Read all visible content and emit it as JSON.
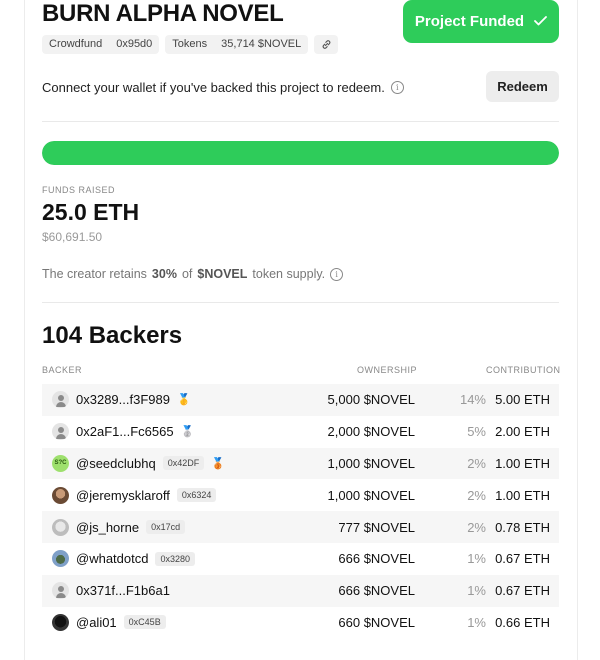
{
  "project": {
    "title": "BURN ALPHA NOVEL",
    "funded_label": "Project Funded",
    "tags": {
      "type_label": "Crowdfund",
      "address": "0x95d0",
      "tokens_label": "Tokens",
      "tokens_value": "35,714 $NOVEL"
    }
  },
  "wallet": {
    "message": "Connect your wallet if you've backed this project to redeem.",
    "redeem_label": "Redeem"
  },
  "funding": {
    "progress": 1.0,
    "raised_label": "FUNDS RAISED",
    "raised_value": "25.0 ETH",
    "raised_usd": "$60,691.50",
    "retain_prefix": "The creator retains",
    "retain_pct": "30%",
    "retain_of": "of",
    "retain_token": "$NOVEL",
    "retain_suffix": "token supply."
  },
  "backers": {
    "title": "104 Backers",
    "columns": {
      "backer": "BACKER",
      "ownership": "OWNERSHIP",
      "contribution": "CONTRIBUTION"
    },
    "rows": [
      {
        "name": "0x3289...f3F989",
        "addr": "",
        "medal": "gold",
        "ownership": "5,000 $NOVEL",
        "pct": "14%",
        "contribution": "5.00 ETH",
        "avatar": "default"
      },
      {
        "name": "0x2aF1...Fc6565",
        "addr": "",
        "medal": "silver",
        "ownership": "2,000 $NOVEL",
        "pct": "5%",
        "contribution": "2.00 ETH",
        "avatar": "default"
      },
      {
        "name": "@seedclubhq",
        "addr": "0x42DF",
        "medal": "bronze",
        "ownership": "1,000 $NOVEL",
        "pct": "2%",
        "contribution": "1.00 ETH",
        "avatar": "seed",
        "avatar_text": "S?C"
      },
      {
        "name": "@jeremysklaroff",
        "addr": "0x6324",
        "medal": "",
        "ownership": "1,000 $NOVEL",
        "pct": "2%",
        "contribution": "1.00 ETH",
        "avatar": "photo1"
      },
      {
        "name": "@js_horne",
        "addr": "0x17cd",
        "medal": "",
        "ownership": "777 $NOVEL",
        "pct": "2%",
        "contribution": "0.78 ETH",
        "avatar": "photo2"
      },
      {
        "name": "@whatdotcd",
        "addr": "0x3280",
        "medal": "",
        "ownership": "666 $NOVEL",
        "pct": "1%",
        "contribution": "0.67 ETH",
        "avatar": "photo3"
      },
      {
        "name": "0x371f...F1b6a1",
        "addr": "",
        "medal": "",
        "ownership": "666 $NOVEL",
        "pct": "1%",
        "contribution": "0.67 ETH",
        "avatar": "default"
      },
      {
        "name": "@ali01",
        "addr": "0xC45B",
        "medal": "",
        "ownership": "660 $NOVEL",
        "pct": "1%",
        "contribution": "0.66 ETH",
        "avatar": "photo4"
      }
    ]
  },
  "colors": {
    "accent_green": "#2ecc5a",
    "muted_gray": "#888888"
  }
}
